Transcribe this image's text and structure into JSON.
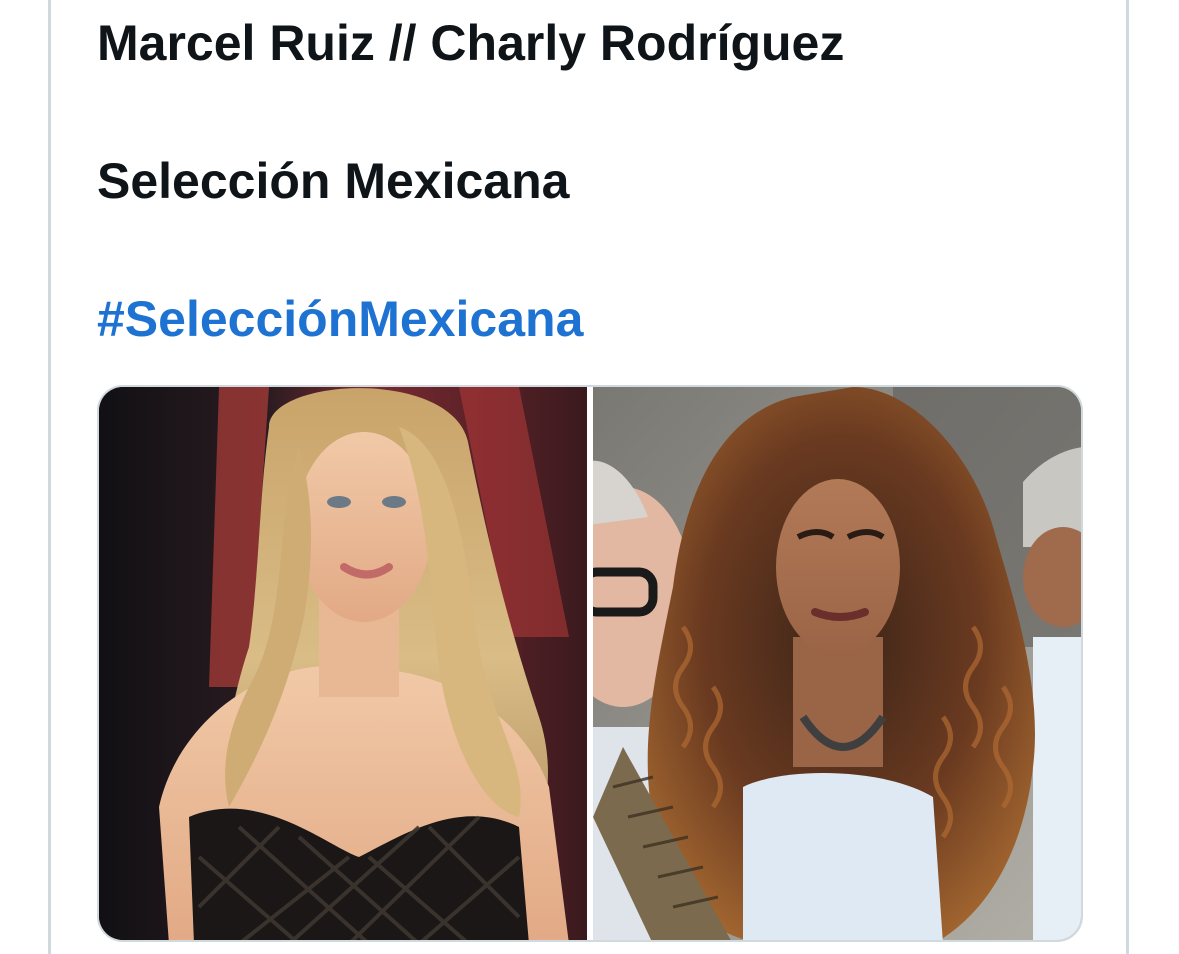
{
  "tweet": {
    "line1": "Marcel Ruiz // Charly Rodríguez",
    "line2": "Selección Mexicana",
    "hashtag": "#SelecciónMexicana"
  },
  "colors": {
    "text": "#0f1419",
    "hashtag": "#1d72d2",
    "border": "#cfd9de"
  },
  "media": {
    "count": 2,
    "photos": [
      {
        "icon": "photo-woman-blonde"
      },
      {
        "icon": "photo-woman-curly-hair"
      }
    ]
  }
}
